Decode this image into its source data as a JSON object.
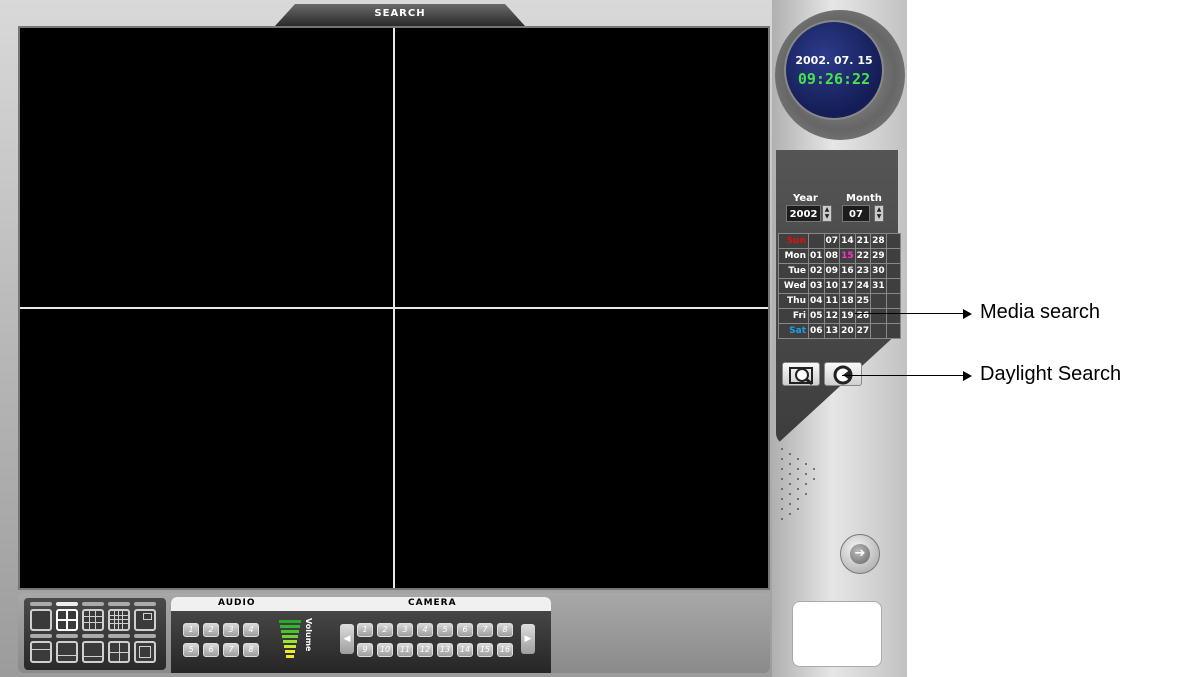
{
  "window": {
    "title": "SEARCH"
  },
  "clock": {
    "date": "2002. 07. 15",
    "time": "09:26:22"
  },
  "date_picker": {
    "year_label": "Year",
    "month_label": "Month",
    "year_value": "2002",
    "month_value": "07"
  },
  "calendar": {
    "rows": [
      {
        "day": "Sun",
        "dates": [
          "",
          "07",
          "14",
          "21",
          "28",
          ""
        ]
      },
      {
        "day": "Mon",
        "dates": [
          "01",
          "08",
          "15",
          "22",
          "29",
          ""
        ]
      },
      {
        "day": "Tue",
        "dates": [
          "02",
          "09",
          "16",
          "23",
          "30",
          ""
        ]
      },
      {
        "day": "Wed",
        "dates": [
          "03",
          "10",
          "17",
          "24",
          "31",
          ""
        ]
      },
      {
        "day": "Thu",
        "dates": [
          "04",
          "11",
          "18",
          "25",
          "",
          ""
        ]
      },
      {
        "day": "Fri",
        "dates": [
          "05",
          "12",
          "19",
          "26",
          "",
          ""
        ]
      },
      {
        "day": "Sat",
        "dates": [
          "06",
          "13",
          "20",
          "27",
          "",
          ""
        ]
      }
    ],
    "selected": "15",
    "colors": {
      "sunday": "#e01010",
      "saturday": "#1aa0e8",
      "selected": "#ff33cc"
    }
  },
  "bottom": {
    "audio_label": "AUDIO",
    "camera_label": "CAMERA",
    "volume_label": "Volume",
    "audio_channels": [
      "1",
      "2",
      "3",
      "4",
      "5",
      "6",
      "7",
      "8"
    ],
    "camera_channels": [
      "1",
      "2",
      "3",
      "4",
      "5",
      "6",
      "7",
      "8",
      "9",
      "10",
      "11",
      "12",
      "13",
      "14",
      "15",
      "16"
    ]
  },
  "annotations": {
    "media_search": "Media search",
    "daylight_search": "Daylight Search"
  },
  "icons": {
    "media_search": "magnifier-icon",
    "daylight_search": "clock-search-icon",
    "next": "arrow-right-circle-icon"
  }
}
